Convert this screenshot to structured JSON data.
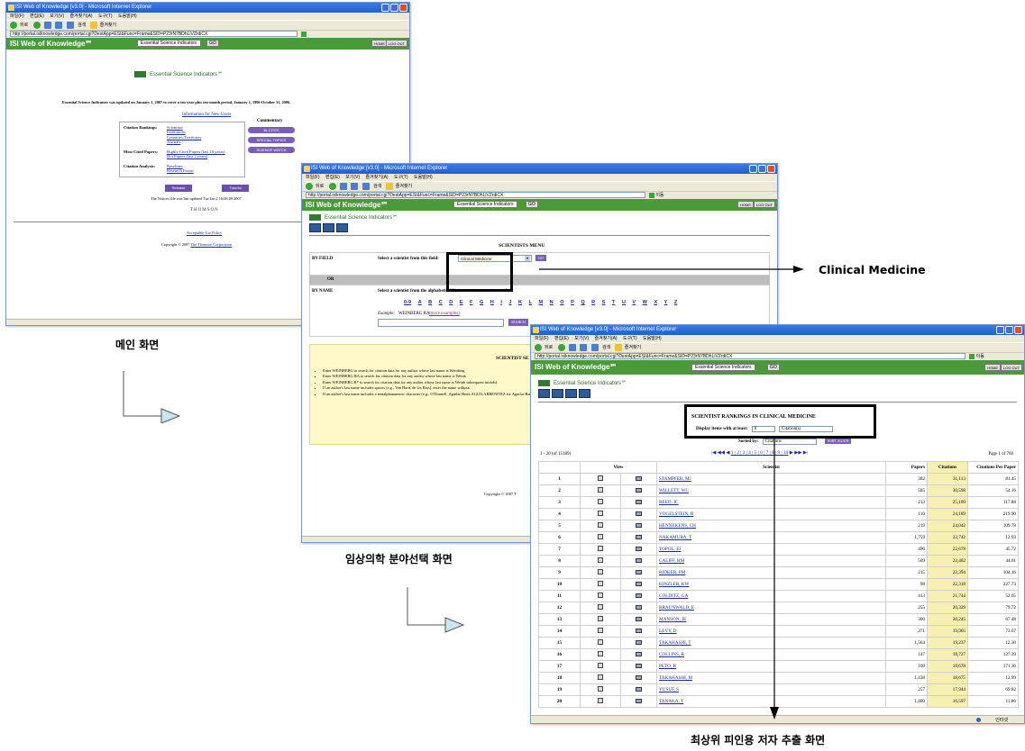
{
  "ie_title_w1": "ISI Web of Knowledge [v3.0] - Microsoft Internet Explorer",
  "ie_title": "ISI Web of Knowledge [v3.0] - Microsoft Internet Explorer",
  "menu_items": [
    "파일(F)",
    "편집(E)",
    "보기(V)",
    "즐겨찾기(A)",
    "도구(T)",
    "도움말(H)"
  ],
  "toolbar": {
    "back": "뒤로",
    "search": "검색",
    "favorites": "즐겨찾기"
  },
  "address": {
    "w1": "http://portal.isiknowledge.com/portal.cgi?DestApp=ESI&Func=Frame&SID=P23rN7BDhLiVZrdiCX",
    "w2": "http://portal.isiknowledge.com/portal.cgi?DestApp=ESI&Func=Frame&SID=P23rN7BDhLiVZrdiCX",
    "w3": "http://portal.isiknowledge.com/portal.cgi?DestApp=ESI&Func=Frame&SID=P23rN7BDhLiVZrdiCX",
    "go": "이동",
    "links": "연결"
  },
  "isi_brand": "ISI Web of Knowledge℠",
  "esi_select": "Essential Science Indicators",
  "go_label": "GO",
  "home_label": "HOME",
  "logout_label": "LOG OUT",
  "esi_logo_text": "Essential Science Indicators℠",
  "w1_page": {
    "update_notice": "Essential Science Indicators was updated on January 1, 2007 to cover a ten-year plus ten-month period, January 1, 1996-October 31, 2006.",
    "info_link": "Information for New Users",
    "commentary_title": "Commentary",
    "commentary_buttons": [
      "IN-CITES",
      "SPECIAL TOPICS",
      "SCIENCE WATCH"
    ],
    "sections": [
      {
        "label": "Citation Rankings:",
        "links": [
          "Scientists",
          "Institutions",
          "Countries/Territories",
          "Journals"
        ]
      },
      {
        "label": "Most Cited Papers:",
        "links": [
          "Highly Cited Papers (last 10 years)",
          "Hot Papers (last 2 years)"
        ]
      },
      {
        "label": "Citation Analysis:",
        "links": [
          "Baselines",
          "Research Fronts"
        ]
      }
    ],
    "buttons": [
      "Release",
      "Tutorial"
    ],
    "last_updated": "The Notices file was last updated Tue Jan 2 16:06:09 2007",
    "thomson": "THOMSON",
    "policy_link": "Acceptable Use Policy",
    "copyright": "Copyright © 2007",
    "copyright_link": "The Thomson Corporation"
  },
  "w2_page": {
    "menu_title": "SCIENTISTS MENU",
    "by_field_label": "BY FIELD",
    "by_field_prompt": "Select a scientist from this field:",
    "field_value": "Clinical Medicine",
    "or_label": "OR",
    "by_name_label": "BY NAME",
    "by_name_prompt": "Select a scientist from the alphabetical list or enter a name to search.",
    "letters": [
      "0-9",
      "A",
      "B",
      "C",
      "D",
      "E",
      "F",
      "G",
      "H",
      "I",
      "J",
      "K",
      "L",
      "M",
      "N",
      "O",
      "P",
      "Q",
      "R",
      "S",
      "T",
      "U",
      "V",
      "W",
      "X",
      "Y",
      "Z"
    ],
    "example_label": "Example:",
    "example_value": "WEINBERG RA",
    "more_examples": "(more examples)",
    "search_btn": "SEARCH",
    "tips_title": "SCIENTIST SE",
    "tips": [
      "Enter WEINBERG to search for citation data for any author whose last name is Weinberg",
      "Enter WEINBERG RA to search for citation data for any author whose last name is Weinb",
      "Enter WEINBERG R* to search for citation data for any author whose last name is Weinb subsequent initials).",
      "If an author's last name includes spaces (e.g., Van Horn, de los Rios), enter the name without",
      "If an author's last name includes a nonalphanumeric character (e.g., O'Donnell, Aguilar-Benit AGUILARBENITEZ for Aguilar-Benitez)."
    ],
    "copyright": "Copyright © 2007 T"
  },
  "w3_page": {
    "heading": "SCIENTIST RANKINGS IN CLINICAL MEDICINE",
    "display_label": "Display items with at least:",
    "display_value": "0",
    "display_metric": "Citation(s)",
    "sorted_label": "Sorted by:",
    "sorted_value": "Citations",
    "sort_btn": "SORT AGAIN",
    "range": "1 - 20 (of 15189)",
    "pages": "1 | 2 | 3 | 4 | 5 | 6 | 7 | 8 | 9 | 10",
    "page_of": "Page 1 of 760",
    "columns": [
      "",
      "View",
      "",
      "Scientist",
      "Papers",
      "Citations",
      "Citations Per Paper"
    ],
    "rows": [
      [
        "1",
        "STAMPFER, MJ",
        "382",
        "31,113",
        "81.45"
      ],
      [
        "2",
        "WILLETT, WC",
        "565",
        "30,598",
        "54.16"
      ],
      [
        "3",
        "REED, JC",
        "213",
        "25,109",
        "117.88"
      ],
      [
        "4",
        "VOGELSTEIN, B",
        "110",
        "24,189",
        "219.90"
      ],
      [
        "5",
        "HENNEKENS, CH",
        "219",
        "24,042",
        "109.78"
      ],
      [
        "6",
        "NAKAMURA, T",
        "1,759",
        "22,742",
        "12.93"
      ],
      [
        "7",
        "TOPOL, EJ",
        "496",
        "22,678",
        "45.72"
      ],
      [
        "8",
        "CALIFF, RM",
        "509",
        "22,402",
        "44.01"
      ],
      [
        "9",
        "RIDKER, PM",
        "215",
        "22,394",
        "104.16"
      ],
      [
        "10",
        "KINZLER, KW",
        "98",
        "22,318",
        "227.73"
      ],
      [
        "11",
        "COLDITZ, GA",
        "413",
        "21,744",
        "52.65"
      ],
      [
        "12",
        "BRAUNWALD, E",
        "255",
        "20,329",
        "79.72"
      ],
      [
        "13",
        "MANSON, JE",
        "300",
        "20,245",
        "67.48"
      ],
      [
        "14",
        "LEVY, D",
        "271",
        "19,965",
        "73.67"
      ],
      [
        "15",
        "TAKAHASHI, T",
        "1,564",
        "19,237",
        "12.30"
      ],
      [
        "16",
        "COLLINS, R",
        "147",
        "18,727",
        "127.39"
      ],
      [
        "17",
        "PETO, R",
        "109",
        "18,678",
        "171.36"
      ],
      [
        "18",
        "TAKAHASHI, M",
        "1,438",
        "18,675",
        "12.99"
      ],
      [
        "19",
        "YUSUF, S",
        "257",
        "17,944",
        "69.82"
      ],
      [
        "20",
        "TANAKA, T",
        "1,400",
        "16,597",
        "11.86"
      ]
    ],
    "status_text": "인터넷"
  },
  "labels": {
    "main_screen": "메인 화면",
    "field_select_screen": "임상의학 분야선택 화면",
    "top_cited_screen": "최상위 피인용 저자 추출 화면",
    "clinical_medicine": "Clinical Medicine"
  }
}
